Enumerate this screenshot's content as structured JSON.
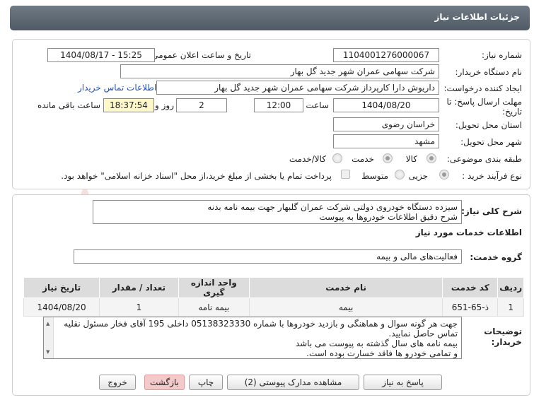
{
  "header": {
    "title": "جزئیات اطلاعات نیاز"
  },
  "details": {
    "need_number_label": "شماره نیاز:",
    "need_number": "1104001276000067",
    "announce_label": "تاریخ و ساعت اعلان عمومی:",
    "announce_value": "1404/08/17 - 15:25",
    "buyer_org_label": "نام دستگاه خریدار:",
    "buyer_org": "شرکت سهامی عمران شهر جدید گل بهار",
    "creator_label": "ایجاد کننده درخواست:",
    "creator": "داریوش دارا کارپرداز شرکت سهامی عمران شهر جدید گل بهار",
    "contact_link": "اطلاعات تماس خریدار",
    "deadline_label": "مهلت ارسال پاسخ: تا تاریخ:",
    "deadline_date": "1404/08/20",
    "hour_label": "ساعت",
    "deadline_time": "12:00",
    "days_value": "2",
    "days_label": "روز و",
    "remaining_time": "18:37:54",
    "remaining_label": "ساعت باقی مانده",
    "province_label": "استان محل تحویل:",
    "province": "خراسان رضوی",
    "city_label": "شهر محل تحویل:",
    "city": "مشهد",
    "category_label": "طبقه بندی موضوعی:",
    "category_options": [
      "کالا",
      "خدمت",
      "کالا/خدمت"
    ],
    "process_label": "نوع فرآیند خرید :",
    "process_options": [
      "جزیی",
      "متوسط"
    ],
    "payment_note": "پرداخت تمام یا بخشی از مبلغ خرید،از محل \"اسناد خزانه اسلامی\" خواهد بود."
  },
  "description": {
    "label": "شرح کلی نیاز:",
    "line1": "سیزده دستگاه خودروی دولتی شرکت عمران گلبهار جهت بیمه نامه بدنه",
    "line2": "شرح دقیق اطلاعات خودروها به پیوست"
  },
  "services": {
    "section_title": "اطلاعات خدمات مورد نیاز",
    "group_label": "گروه خدمت:",
    "group_value": "فعالیت‌های مالی و بیمه",
    "columns": [
      "ردیف",
      "کد خدمت",
      "نام خدمت",
      "واحد اندازه گیری",
      "تعداد / مقدار",
      "تاریخ نیاز"
    ],
    "rows": [
      [
        "1",
        "ذ-65-651",
        "بیمه",
        "بیمه نامه",
        "1",
        "1404/08/20"
      ]
    ]
  },
  "buyer_notes": {
    "label": "توضیحات خریدار:",
    "lines": [
      "جهت هر گونه سوال و هماهنگی و بازدید خودروها با شماره 05138323330 داخلی 195 آقای فخار مسئول نقلیه تماس حاصل نمایید.",
      "بیمه نامه های سال گذشته به پیوست می باشد",
      "و تمامی خودرو ها فاقد خسارت بوده است."
    ]
  },
  "buttons": {
    "reply": "پاسخ به نیاز",
    "attachments": "مشاهده مدارک پیوستی (2)",
    "print": "چاپ",
    "back": "بازگشت",
    "exit": "خروج"
  },
  "watermark": {
    "text": "AriaTender.net"
  }
}
